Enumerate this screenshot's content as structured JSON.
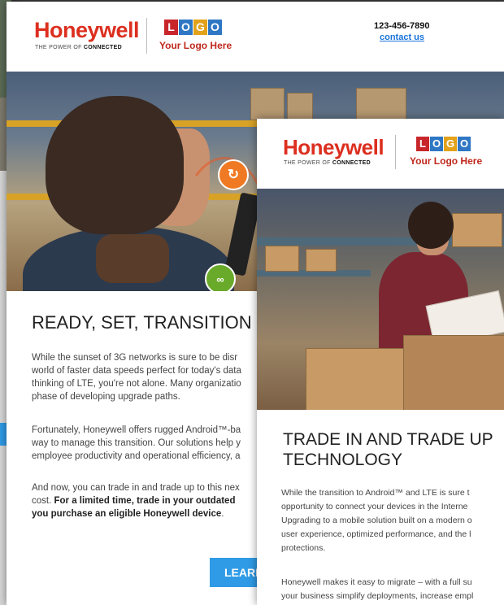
{
  "brand": {
    "name": "Honeywell",
    "tagline_lead": "THE POWER OF",
    "tagline_bold": "CONNECTED",
    "partner_logo_letters": [
      "L",
      "O",
      "G",
      "O"
    ],
    "partner_logo_colors": [
      "#c8262b",
      "#2f77c4",
      "#e3a21a",
      "#2f77c4"
    ],
    "partner_caption": "Your Logo Here"
  },
  "email_front": {
    "phone": "123-456-7890",
    "contact_label": "contact us",
    "title": "READY, SET, TRANSITION",
    "paragraphs": [
      [
        "While the sunset of 3G networks is sure to be disr",
        "world of faster data speeds perfect for today's data",
        "thinking of LTE, you're not alone. Many organizatio",
        "phase of developing upgrade paths."
      ],
      [
        "Fortunately, Honeywell offers rugged Android™-ba",
        "way to manage this transition. Our solutions help y",
        "employee productivity and operational efficiency, a"
      ]
    ],
    "closing_line1": "And now, you can trade in and trade up to this nex",
    "closing_bold1": "cost. ",
    "closing_bold2": "For a limited time, trade in your outdated",
    "closing_bold3": "you purchase an eligible Honeywell device",
    "closing_tail": ".",
    "cta_label": "LEARN"
  },
  "email_overlay": {
    "title_line1": "TRADE IN AND TRADE UP",
    "title_line2": "TECHNOLOGY",
    "paragraphs": [
      [
        "While the transition to Android™ and LTE is sure t",
        "opportunity to connect your devices in the Interne",
        "Upgrading to a mobile solution built on a modern o",
        "user experience, optimized performance, and the l",
        "protections."
      ],
      [
        "Honeywell makes it easy to migrate – with a full su",
        "your business simplify deployments, increase empl"
      ]
    ]
  },
  "colors": {
    "brand_red": "#dc2f1f",
    "cta_blue": "#2f9be6",
    "link_blue": "#1a73d9",
    "orange_icon": "#f07a23",
    "green_icon": "#6aaa2a"
  }
}
